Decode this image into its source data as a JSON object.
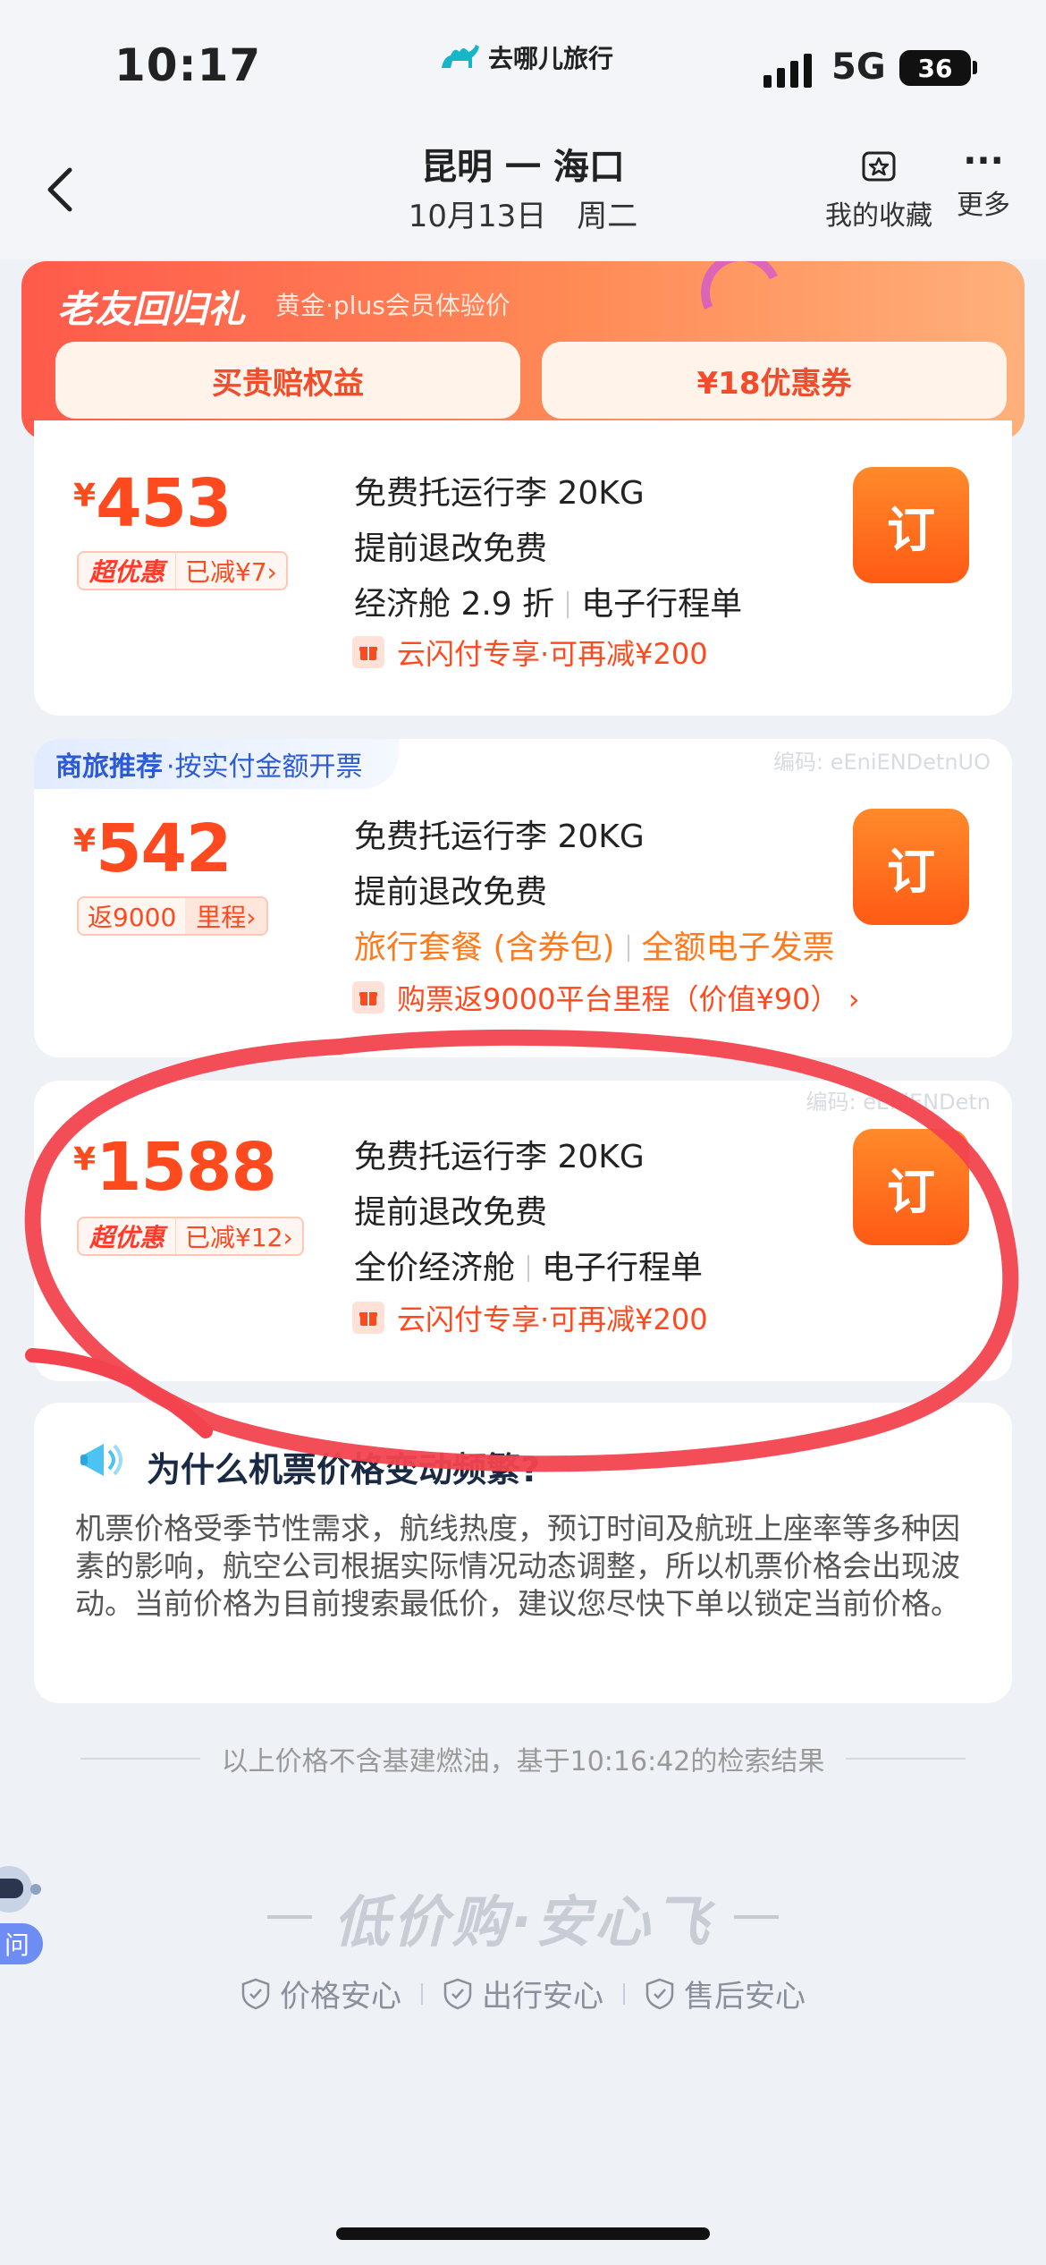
{
  "status_bar": {
    "time": "10:17",
    "app_brand": "去哪儿旅行",
    "network": "5G",
    "battery": "36"
  },
  "nav": {
    "route": "昆明 一 海口",
    "date": "10月13日　周二",
    "favorites_label": "我的收藏",
    "more_label": "更多"
  },
  "promo": {
    "title": "老友回归礼",
    "subtitle": "黄金·plus会员体验价",
    "button_left": "买贵赔权益",
    "button_right": "¥18优惠券"
  },
  "flights": [
    {
      "currency": "¥",
      "price": "453",
      "badge_left": "超优惠",
      "badge_right": "已减¥7›",
      "features": [
        "免费托运行李 20KG",
        "提前退改免费"
      ],
      "feature_pair": [
        "经济舱 2.9 折",
        "电子行程单"
      ],
      "offer": "云闪付专享·可再减¥200",
      "book_label": "订"
    },
    {
      "tag_bold": "商旅推荐",
      "tag_text": "·按实付金额开票",
      "code": "编码: eEniENDetnUO",
      "currency": "¥",
      "price": "542",
      "badge_left": "返9000",
      "badge_right": "里程›",
      "features": [
        "免费托运行李 20KG",
        "提前退改免费"
      ],
      "feature_pair": [
        "旅行套餐 (含券包)",
        "全额电子发票"
      ],
      "offer": "购票返9000平台里程（价值¥90） ›",
      "book_label": "订"
    },
    {
      "code": "编码: eEniENDetn",
      "currency": "¥",
      "price": "1588",
      "badge_left": "超优惠",
      "badge_right": "已减¥12›",
      "features": [
        "免费托运行李 20KG",
        "提前退改免费"
      ],
      "feature_pair": [
        "全价经济舱",
        "电子行程单"
      ],
      "offer": "云闪付专享·可再减¥200",
      "book_label": "订"
    }
  ],
  "info": {
    "title": "为什么机票价格变动频繁?",
    "body": "机票价格受季节性需求，航线热度，预订时间及航班上座率等多种因素的影响，航空公司根据实际情况动态调整，所以机票价格会出现波动。当前价格为目前搜索最低价，建议您尽快下单以锁定当前价格。"
  },
  "footnote": "以上价格不含基建燃油，基于10:16:42的检索结果",
  "slogan": "低价购·安心飞",
  "guarantees": [
    "价格安心",
    "出行安心",
    "售后安心"
  ],
  "assistant_label": "问",
  "colors": {
    "accent": "#ff4a1f",
    "book_button": "#ff5a14",
    "annotation_stroke": "#f2434f"
  }
}
